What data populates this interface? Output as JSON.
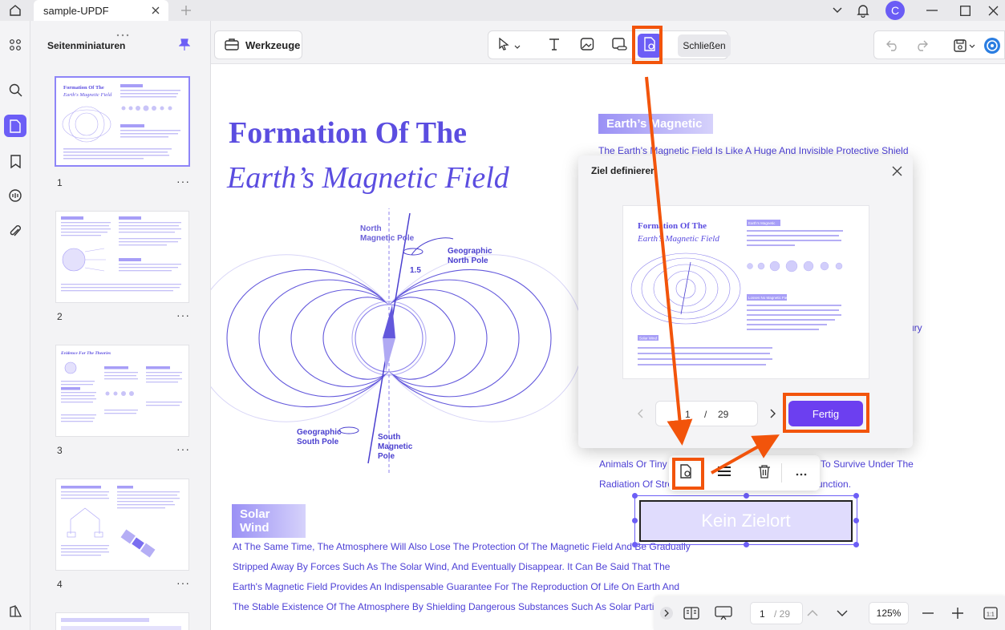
{
  "window": {
    "tab_title": "sample-UPDF",
    "avatar_letter": "C"
  },
  "sidebar": {
    "title": "Seitenminiaturen",
    "pages": [
      {
        "num": "1"
      },
      {
        "num": "2"
      },
      {
        "num": "3"
      },
      {
        "num": "4"
      }
    ],
    "more": "···"
  },
  "toolbar": {
    "tools_label": "Werkzeuge",
    "close_label": "Schließen"
  },
  "document": {
    "title_line1": "Formation Of The",
    "title_line2": "Earth’s Magnetic Field",
    "section_magnetic": "Earth’s Magnetic",
    "magnetic_text": "The Earth's Magnetic Field Is Like A Huge And Invisible Protective Shield",
    "label_north_magnetic": "North\nMagnetic Pole",
    "label_geographic_north": "Geographic\nNorth Pole",
    "label_angle": "1.5",
    "label_geographic_south": "Geographic\nSouth Pole",
    "label_south_magnetic": "South\nMagnetic\nPole",
    "partial_line1": "Animals Or Tiny I",
    "partial_line1_end": "To Survive Under The",
    "partial_line2": "Radiation Of Stro",
    "partial_line2_end": "unction.",
    "section_solar": "Solar Wind",
    "solar_lines": [
      "At The Same Time, The Atmosphere Will Also Lose The Protection Of The Magnetic Field And Be Gradually",
      "Stripped Away By Forces Such As The Solar Wind, And Eventually Disappear. It Can Be Said That The",
      "Earth's Magnetic Field Provides An Indispensable Guarantee For The Reproduction Of Life On Earth And",
      "The Stable Existence Of The Atmosphere By Shielding Dangerous Substances Such As Solar Particle"
    ],
    "link_placeholder": "Kein Zielort",
    "cut_ury": "ury"
  },
  "dialog": {
    "title": "Ziel definieren",
    "preview": {
      "title1": "Formation Of The",
      "title2": "Earth’s Magnetic Field",
      "tag1": "Earth's Magnetic",
      "tag2": "Losses No Magnetic Field",
      "tag3": "Solar Wind"
    },
    "current_page": "1",
    "separator": "/",
    "total_pages": "29",
    "done_label": "Fertig"
  },
  "bottombar": {
    "current_page": "1",
    "total_pages": "/ 29",
    "zoom": "125%"
  },
  "colors": {
    "accent": "#6c5ef6",
    "primary_text": "#4c3fd6",
    "highlight": "#f2540b",
    "done_button": "#6c3ff0"
  }
}
